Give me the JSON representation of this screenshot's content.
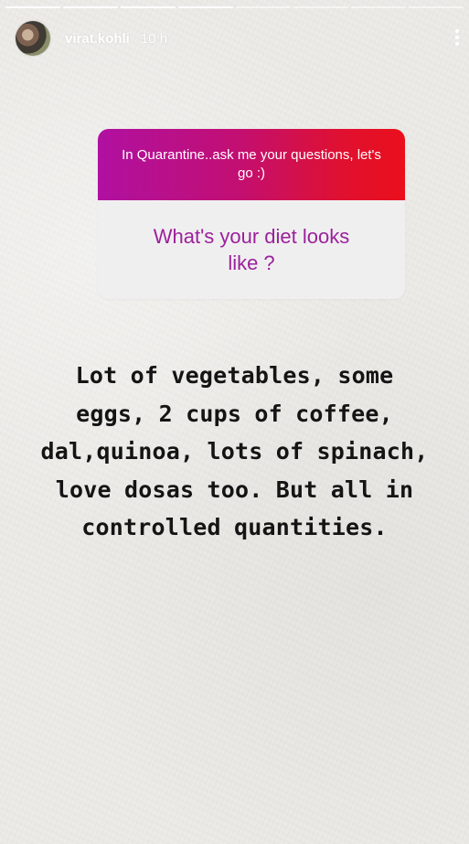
{
  "story": {
    "progress_segments": 8,
    "progress_completed": 4,
    "user": {
      "username": "virat.kohli",
      "time_ago": "10 h"
    },
    "question_sticker": {
      "prompt": "In Quarantine..ask me your questions, let's go :)",
      "question": "What's your diet looks like ?"
    },
    "answer_text": "Lot of vegetables, some eggs, 2 cups of coffee, dal,quinoa, lots of spinach, love dosas too. But all in controlled quantities.",
    "icons": [
      "profile-avatar",
      "more-options-icon"
    ],
    "colors": {
      "sticker_gradient_start": "#b010a1",
      "sticker_gradient_end": "#ea0f1c",
      "question_text": "#9b219b",
      "answer_text": "#141414",
      "background": "#ecebe7"
    }
  }
}
